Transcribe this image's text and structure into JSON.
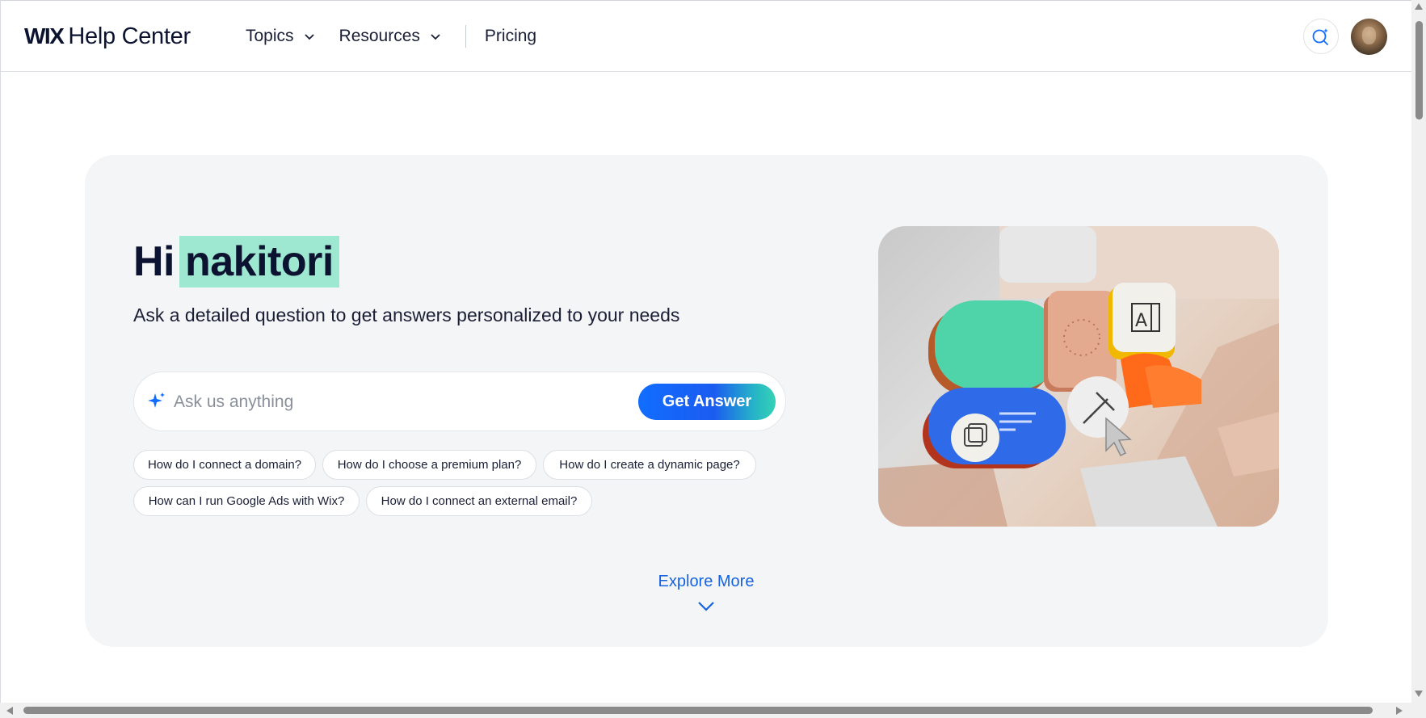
{
  "header": {
    "logo_brand": "WIX",
    "logo_text": "Help Center",
    "nav": {
      "topics": "Topics",
      "resources": "Resources",
      "pricing": "Pricing"
    },
    "icons": {
      "search": "ai-search-icon",
      "avatar": "user-avatar"
    }
  },
  "hero": {
    "greeting_prefix": "Hi",
    "user_name": "nakitori",
    "subtitle": "Ask a detailed question to get answers personalized to your needs",
    "search": {
      "placeholder": "Ask us anything",
      "value": "",
      "button_label": "Get Answer",
      "icon": "sparkle-icon"
    },
    "suggestions": [
      "How do I connect a domain?",
      "How do I choose a premium plan?",
      "How do I create a dynamic page?",
      "How can I run Google Ads with Wix?",
      "How do I connect an external email?"
    ],
    "explore_label": "Explore More"
  },
  "colors": {
    "accent": "#116dff",
    "highlight": "#9ee7d0",
    "card_bg": "#f4f5f7",
    "text_dark": "#0c1330"
  }
}
